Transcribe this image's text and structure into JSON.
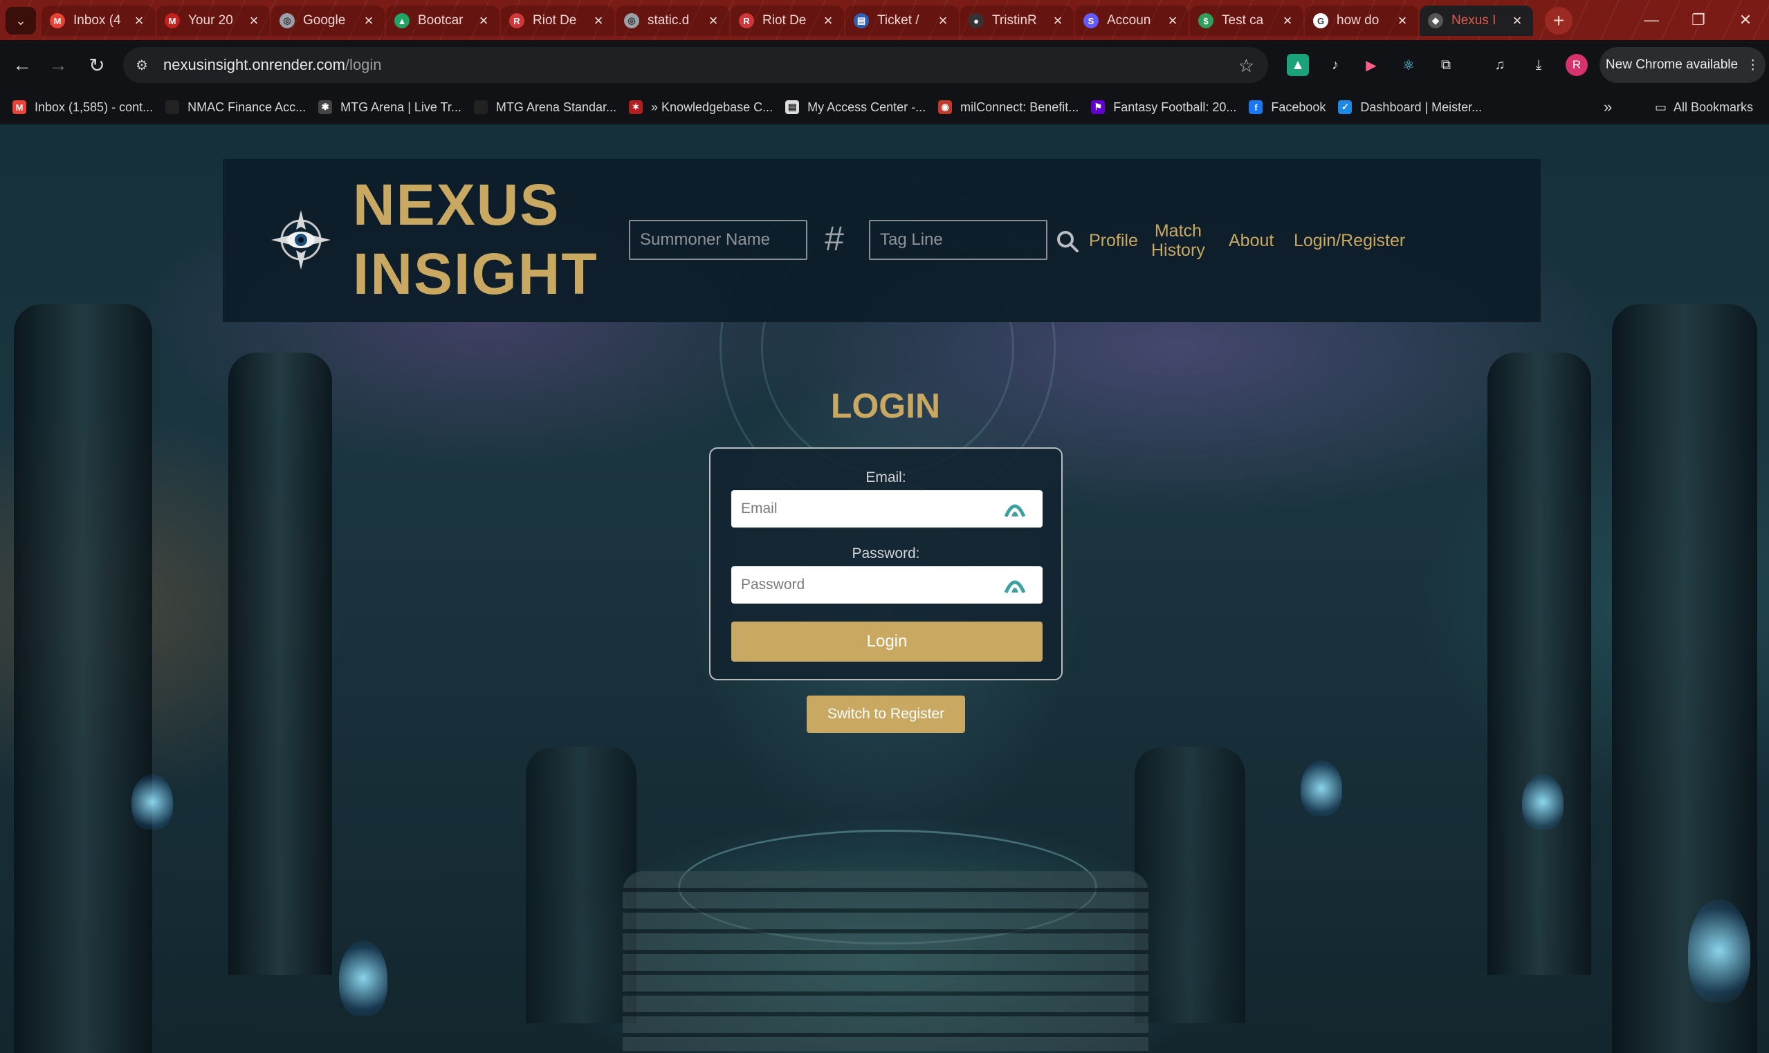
{
  "browser": {
    "tabs": [
      {
        "title": "Inbox (4",
        "favicon": "gmail-icon",
        "fav_color": "#ea4335",
        "fav_glyph": "M"
      },
      {
        "title": "Your 20",
        "favicon": "gmail-icon",
        "fav_color": "#c5221f",
        "fav_glyph": "M"
      },
      {
        "title": "Google",
        "favicon": "globe-icon",
        "fav_color": "#9aa0a6",
        "fav_glyph": "◎"
      },
      {
        "title": "Bootcar",
        "favicon": "drive-icon",
        "fav_color": "#1fa463",
        "fav_glyph": "▲"
      },
      {
        "title": "Riot De",
        "favicon": "riot-icon",
        "fav_color": "#d13639",
        "fav_glyph": "R"
      },
      {
        "title": "static.d",
        "favicon": "globe-icon",
        "fav_color": "#9aa0a6",
        "fav_glyph": "◎"
      },
      {
        "title": "Riot De",
        "favicon": "riot-icon",
        "fav_color": "#d13639",
        "fav_glyph": "R"
      },
      {
        "title": "Ticket /",
        "favicon": "ticket-icon",
        "fav_color": "#2d5fb8",
        "fav_glyph": "▤"
      },
      {
        "title": "TristinR",
        "favicon": "github-icon",
        "fav_color": "#333333",
        "fav_glyph": "●"
      },
      {
        "title": "Accoun",
        "favicon": "stripe-icon",
        "fav_color": "#635bff",
        "fav_glyph": "S"
      },
      {
        "title": "Test ca",
        "favicon": "money-icon",
        "fav_color": "#2e9e5b",
        "fav_glyph": "$"
      },
      {
        "title": "how do",
        "favicon": "google-icon",
        "fav_color": "#ffffff",
        "fav_glyph": "G"
      },
      {
        "title": "Nexus I",
        "favicon": "nexus-icon",
        "fav_color": "#555555",
        "fav_glyph": "◆"
      }
    ],
    "url_host": "nexusinsight.onrender.com",
    "url_path": "/login",
    "update_label": "New Chrome available",
    "avatar_letter": "R",
    "bookmarks": [
      {
        "label": "Inbox (1,585) - cont...",
        "icon": "gmail-icon",
        "color": "#ea4335",
        "glyph": "M"
      },
      {
        "label": "NMAC Finance Acc...",
        "icon": "nissan-icon",
        "color": "#222222",
        "glyph": ""
      },
      {
        "label": "MTG Arena | Live Tr...",
        "icon": "mtg-icon",
        "color": "#444444",
        "glyph": "✱"
      },
      {
        "label": "MTG Arena Standar...",
        "icon": "mtg-icon",
        "color": "#222222",
        "glyph": ""
      },
      {
        "label": "» Knowledgebase C...",
        "icon": "dragon-icon",
        "color": "#b01e1e",
        "glyph": "✶"
      },
      {
        "label": "My Access Center -...",
        "icon": "doc-icon",
        "color": "#dddddd",
        "glyph": "▤"
      },
      {
        "label": "milConnect: Benefit...",
        "icon": "milconnect-icon",
        "color": "#c0392b",
        "glyph": "◉"
      },
      {
        "label": "Fantasy Football: 20...",
        "icon": "yahoo-icon",
        "color": "#6001d2",
        "glyph": "⚑"
      },
      {
        "label": "Facebook",
        "icon": "facebook-icon",
        "color": "#1877f2",
        "glyph": "f"
      },
      {
        "label": "Dashboard | Meister...",
        "icon": "check-icon",
        "color": "#1e88e5",
        "glyph": "✓"
      }
    ],
    "all_bookmarks_label": "All Bookmarks"
  },
  "header": {
    "brand_line1": "NEXUS",
    "brand_line2": "INSIGHT",
    "summoner_placeholder": "Summoner Name",
    "hash_symbol": "#",
    "tagline_placeholder": "Tag Line",
    "nav": {
      "profile": "Profile",
      "match_history_line1": "Match",
      "match_history_line2": "History",
      "about": "About",
      "login_register": "Login/Register"
    }
  },
  "login": {
    "title": "LOGIN",
    "email_label": "Email:",
    "email_placeholder": "Email",
    "password_label": "Password:",
    "password_placeholder": "Password",
    "submit_label": "Login",
    "switch_label": "Switch to Register"
  },
  "colors": {
    "accent_gold": "#c9a862",
    "header_bg": "#0c1c28",
    "tabbar_red": "#7a1b16"
  }
}
